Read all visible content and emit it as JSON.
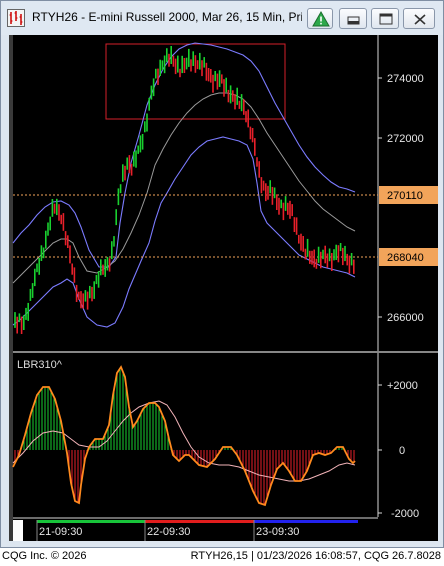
{
  "window": {
    "title": "RTYH26 - E-mini Russell 2000, Mar 26, 15 Min, Pri...",
    "buttons": {
      "alert_icon": "alert-triangle-icon",
      "minimize_icon": "minimize-icon",
      "maximize_icon": "maximize-icon",
      "close_icon": "close-icon"
    }
  },
  "price_panel": {
    "axis_labels": [
      "274000",
      "272000",
      "266000"
    ],
    "highlighted_levels": [
      {
        "label": "270110",
        "value": 270110,
        "color": "#f2a45a"
      },
      {
        "label": "268040",
        "value": 268040,
        "color": "#f2a45a"
      }
    ]
  },
  "indicator_panel": {
    "name": "LBR310^",
    "axis_labels": [
      "+2000",
      "0",
      "-2000"
    ]
  },
  "time_axis": {
    "labels": [
      "21-09:30",
      "22-09:30",
      "23-09:30"
    ],
    "session_colors": [
      "#18c43a",
      "#e11d1d",
      "#2222ee"
    ]
  },
  "colors": {
    "background": "#000000",
    "up_bar": "#19d12f",
    "down_bar": "#e8202a",
    "bollinger_band": "#7b7bff",
    "moving_average": "#9a9a9a",
    "oscillator_line": "#ff8a1e",
    "signal_line": "#f2b3b8",
    "highlight_box": "#d4202a"
  },
  "status": {
    "left": "CQG Inc. © 2026",
    "right": "RTYH26,15 | 01/23/2026 16:08:57, CQG 26.7.8028"
  }
}
